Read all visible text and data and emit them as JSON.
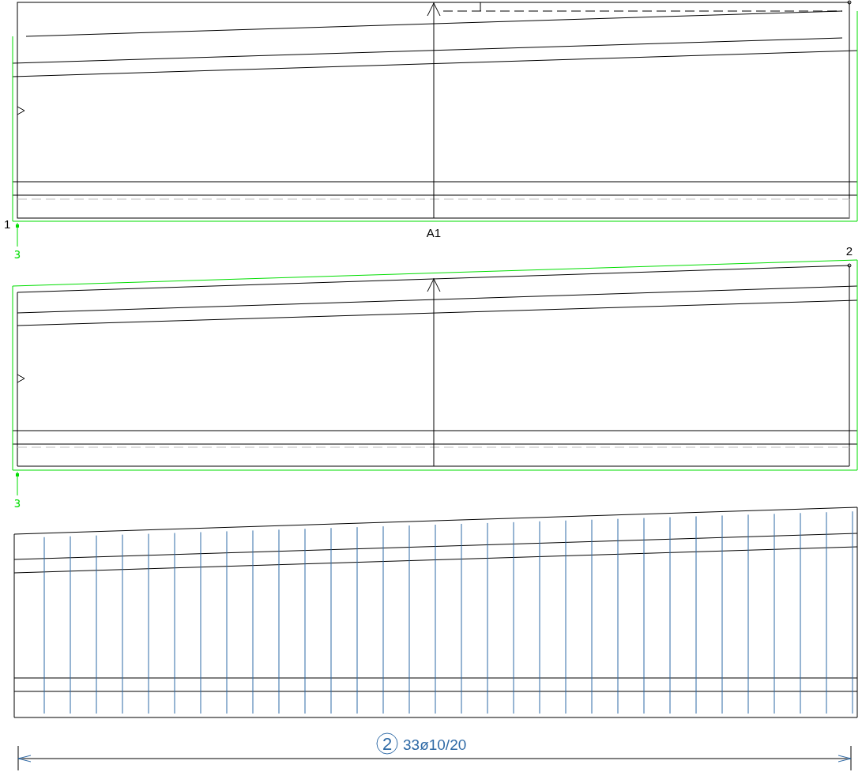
{
  "section_top": {
    "left_label": "1",
    "cut_label": "A1",
    "level_label": "3"
  },
  "section_middle": {
    "corner_label": "2",
    "level_label": "3"
  },
  "reinforcement_dimension": {
    "position_number": "2",
    "bar_text": "33ø10/20"
  }
}
